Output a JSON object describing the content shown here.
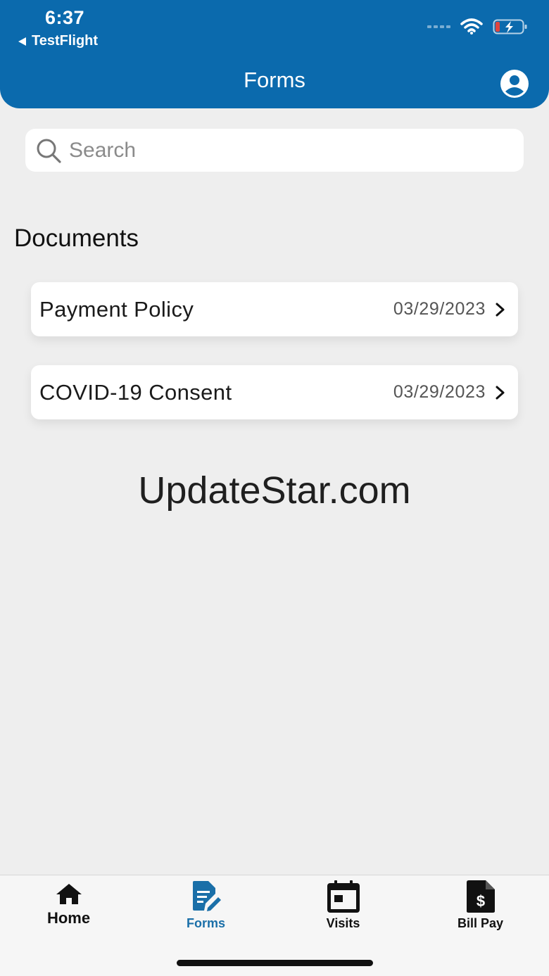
{
  "status_bar": {
    "time": "6:37",
    "back_app": "TestFlight",
    "icons": [
      "signal-dots-icon",
      "wifi-icon",
      "battery-charging-icon"
    ]
  },
  "header": {
    "title": "Forms",
    "profile_icon": "account-circle-icon",
    "color": "#0b6aad"
  },
  "search": {
    "placeholder": "Search",
    "value": "",
    "icon": "search-icon"
  },
  "documents": {
    "section_title": "Documents",
    "items": [
      {
        "name": "Payment Policy",
        "date": "03/29/2023"
      },
      {
        "name": "COVID-19 Consent",
        "date": "03/29/2023"
      }
    ]
  },
  "watermark": "UpdateStar.com",
  "tabbar": {
    "active_color": "#1a6fa8",
    "tabs": [
      {
        "label": "Home",
        "icon": "home-icon",
        "active": false
      },
      {
        "label": "Forms",
        "icon": "forms-edit-icon",
        "active": true
      },
      {
        "label": "Visits",
        "icon": "calendar-icon",
        "active": false
      },
      {
        "label": "Bill Pay",
        "icon": "bill-dollar-icon",
        "active": false
      }
    ]
  }
}
